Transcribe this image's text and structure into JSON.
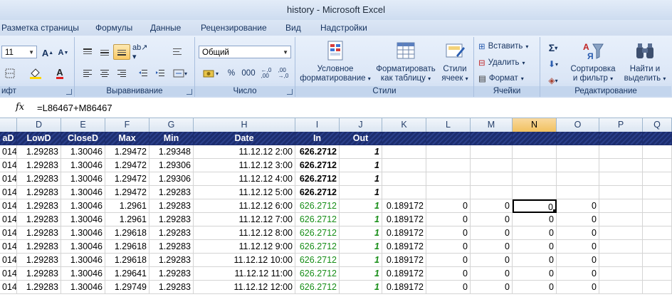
{
  "window": {
    "title": "history - Microsoft Excel"
  },
  "tabs": [
    "Разметка страницы",
    "Формулы",
    "Данные",
    "Рецензирование",
    "Вид",
    "Надстройки"
  ],
  "ribbon": {
    "font": {
      "size": "11",
      "label": "ифт"
    },
    "alignment": {
      "label": "Выравнивание"
    },
    "number": {
      "format": "Общий",
      "percent": "%",
      "thousands": "000",
      "label": "Число"
    },
    "styles": {
      "conditional": [
        "Условное",
        "форматирование"
      ],
      "as_table": [
        "Форматировать",
        "как таблицу"
      ],
      "cell_styles": [
        "Стили",
        "ячеек"
      ],
      "label": "Стили"
    },
    "cells": {
      "insert": "Вставить",
      "delete": "Удалить",
      "format": "Формат",
      "label": "Ячейки"
    },
    "editing": {
      "sort": [
        "Сортировка",
        "и фильтр"
      ],
      "find": [
        "Найти и",
        "выделить"
      ],
      "label": "Редактирование"
    }
  },
  "formula_bar": {
    "fx": "fx",
    "formula": "=L86467+M86467"
  },
  "columns": [
    "D",
    "E",
    "F",
    "G",
    "H",
    "I",
    "J",
    "K",
    "L",
    "M",
    "N",
    "O",
    "P",
    "Q"
  ],
  "active_column": "N",
  "header_row": [
    "aD",
    "LowD",
    "CloseD",
    "Max",
    "Min",
    "Date",
    "In",
    "Out"
  ],
  "rows": [
    [
      "014",
      "1.29283",
      "1.30046",
      "1.29472",
      "1.29348",
      "11.12.12 2:00",
      "626.2712",
      "1",
      "",
      "",
      "",
      "",
      ""
    ],
    [
      "014",
      "1.29283",
      "1.30046",
      "1.29472",
      "1.29306",
      "11.12.12 3:00",
      "626.2712",
      "1",
      "",
      "",
      "",
      "",
      ""
    ],
    [
      "014",
      "1.29283",
      "1.30046",
      "1.29472",
      "1.29306",
      "11.12.12 4:00",
      "626.2712",
      "1",
      "",
      "",
      "",
      "",
      ""
    ],
    [
      "014",
      "1.29283",
      "1.30046",
      "1.29472",
      "1.29283",
      "11.12.12 5:00",
      "626.2712",
      "1",
      "",
      "",
      "",
      "",
      ""
    ],
    [
      "014",
      "1.29283",
      "1.30046",
      "1.2961",
      "1.29283",
      "11.12.12 6:00",
      "626.2712",
      "1",
      "0.189172",
      "0",
      "0",
      "0",
      "0"
    ],
    [
      "014",
      "1.29283",
      "1.30046",
      "1.2961",
      "1.29283",
      "11.12.12 7:00",
      "626.2712",
      "1",
      "0.189172",
      "0",
      "0",
      "0",
      "0"
    ],
    [
      "014",
      "1.29283",
      "1.30046",
      "1.29618",
      "1.29283",
      "11.12.12 8:00",
      "626.2712",
      "1",
      "0.189172",
      "0",
      "0",
      "0",
      "0"
    ],
    [
      "014",
      "1.29283",
      "1.30046",
      "1.29618",
      "1.29283",
      "11.12.12 9:00",
      "626.2712",
      "1",
      "0.189172",
      "0",
      "0",
      "0",
      "0"
    ],
    [
      "014",
      "1.29283",
      "1.30046",
      "1.29618",
      "1.29283",
      "11.12.12 10:00",
      "626.2712",
      "1",
      "0.189172",
      "0",
      "0",
      "0",
      "0"
    ],
    [
      "014",
      "1.29283",
      "1.30046",
      "1.29641",
      "1.29283",
      "11.12.12 11:00",
      "626.2712",
      "1",
      "0.189172",
      "0",
      "0",
      "0",
      "0"
    ],
    [
      "014",
      "1.29283",
      "1.30046",
      "1.29749",
      "1.29283",
      "11.12.12 12:00",
      "626.2712",
      "1",
      "0.189172",
      "0",
      "0",
      "0",
      "0"
    ]
  ],
  "colors": {
    "header_band": "#1c2d6e",
    "green_text": "#168d16",
    "active_col": "#f1c15f"
  }
}
